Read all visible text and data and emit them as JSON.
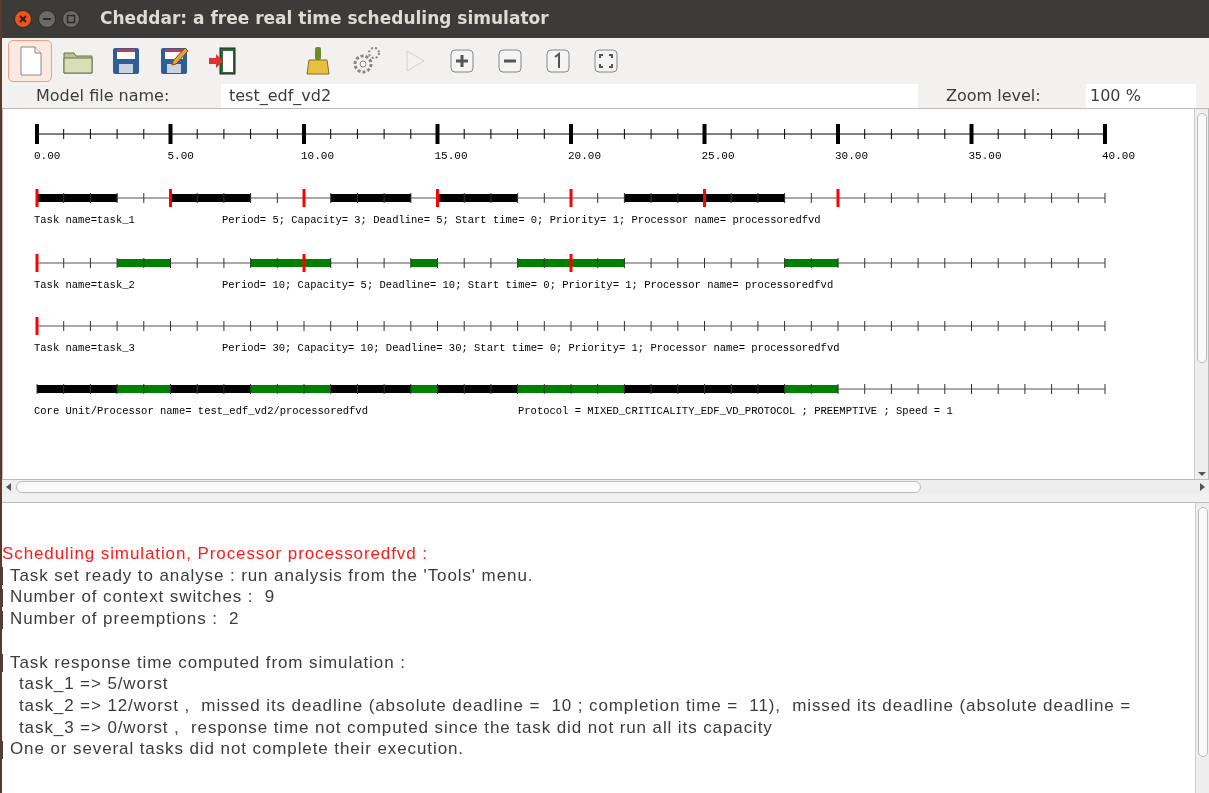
{
  "window": {
    "title": "Cheddar: a free real time scheduling simulator"
  },
  "toolbar": [
    {
      "kind": "new",
      "selected": true,
      "disabled": false
    },
    {
      "kind": "open",
      "selected": false,
      "disabled": false
    },
    {
      "kind": "save",
      "selected": false,
      "disabled": false
    },
    {
      "kind": "save-as",
      "selected": false,
      "disabled": false
    },
    {
      "kind": "exit",
      "selected": false,
      "disabled": false
    },
    {
      "kind": "gap"
    },
    {
      "kind": "clear",
      "selected": false,
      "disabled": false
    },
    {
      "kind": "gears",
      "selected": false,
      "disabled": false
    },
    {
      "kind": "play",
      "selected": false,
      "disabled": true
    },
    {
      "kind": "zoom-in",
      "selected": false,
      "disabled": false
    },
    {
      "kind": "zoom-out",
      "selected": false,
      "disabled": false
    },
    {
      "kind": "zoom-reset",
      "selected": false,
      "disabled": false
    },
    {
      "kind": "zoom-fit",
      "selected": false,
      "disabled": false
    }
  ],
  "info": {
    "model_label": "Model file name:",
    "model_value": "test_edf_vd2",
    "zoom_label": "Zoom level:",
    "zoom_value": "100 %"
  },
  "schedule": {
    "axis_labels": [
      "0.00",
      "5.00",
      "10.00",
      "15.00",
      "20.00",
      "25.00",
      "30.00",
      "35.00",
      "40.00"
    ],
    "rows": [
      {
        "kind": "task",
        "name": "Task name=task_1",
        "details": "Period= 5; Capacity= 3; Deadline= 5; Start time= 0; Priority= 1; Processor name= processoredfvd",
        "color": "#000000",
        "slots": [
          {
            "running": true,
            "release": true
          },
          {
            "running": true,
            "release": false
          },
          {
            "running": true,
            "release": false
          },
          {
            "running": false,
            "release": false
          },
          {
            "running": false,
            "release": false
          },
          {
            "running": true,
            "release": true
          },
          {
            "running": true,
            "release": false
          },
          {
            "running": true,
            "release": false
          },
          {
            "running": false,
            "release": false
          },
          {
            "running": false,
            "release": false
          },
          {
            "running": false,
            "release": true
          },
          {
            "running": true,
            "release": false
          },
          {
            "running": true,
            "release": false
          },
          {
            "running": true,
            "release": false
          },
          {
            "running": false,
            "release": false
          },
          {
            "running": true,
            "release": true
          },
          {
            "running": true,
            "release": false
          },
          {
            "running": true,
            "release": false
          },
          {
            "running": false,
            "release": false
          },
          {
            "running": false,
            "release": false
          },
          {
            "running": false,
            "release": true
          },
          {
            "running": false,
            "release": false
          },
          {
            "running": true,
            "release": false
          },
          {
            "running": true,
            "release": false
          },
          {
            "running": true,
            "release": false
          },
          {
            "running": true,
            "release": true
          },
          {
            "running": true,
            "release": false
          },
          {
            "running": true,
            "release": false
          },
          {
            "running": false,
            "release": false
          },
          {
            "running": false,
            "release": false
          },
          {
            "running": false,
            "release": true
          },
          {
            "running": false,
            "release": false
          },
          {
            "running": false,
            "release": false
          },
          {
            "running": false,
            "release": false
          },
          {
            "running": false,
            "release": false
          },
          {
            "running": false,
            "release": false
          },
          {
            "running": false,
            "release": false
          },
          {
            "running": false,
            "release": false
          },
          {
            "running": false,
            "release": false
          },
          {
            "running": false,
            "release": false
          }
        ]
      },
      {
        "kind": "task",
        "name": "Task name=task_2",
        "details": "Period= 10; Capacity= 5; Deadline= 10; Start time= 0; Priority= 1; Processor name= processoredfvd",
        "color": "#008000",
        "slots": [
          {
            "running": false,
            "release": true
          },
          {
            "running": false,
            "release": false
          },
          {
            "running": false,
            "release": false
          },
          {
            "running": true,
            "release": false
          },
          {
            "running": true,
            "release": false
          },
          {
            "running": false,
            "release": false
          },
          {
            "running": false,
            "release": false
          },
          {
            "running": false,
            "release": false
          },
          {
            "running": true,
            "release": false
          },
          {
            "running": true,
            "release": false
          },
          {
            "running": true,
            "release": true
          },
          {
            "running": false,
            "release": false
          },
          {
            "running": false,
            "release": false
          },
          {
            "running": false,
            "release": false
          },
          {
            "running": true,
            "release": false
          },
          {
            "running": false,
            "release": false
          },
          {
            "running": false,
            "release": false
          },
          {
            "running": false,
            "release": false
          },
          {
            "running": true,
            "release": false
          },
          {
            "running": true,
            "release": false
          },
          {
            "running": true,
            "release": true
          },
          {
            "running": true,
            "release": false
          },
          {
            "running": false,
            "release": false
          },
          {
            "running": false,
            "release": false
          },
          {
            "running": false,
            "release": false
          },
          {
            "running": false,
            "release": false
          },
          {
            "running": false,
            "release": false
          },
          {
            "running": false,
            "release": false
          },
          {
            "running": true,
            "release": false
          },
          {
            "running": true,
            "release": false
          },
          {
            "running": false,
            "release": false
          },
          {
            "running": false,
            "release": false
          },
          {
            "running": false,
            "release": false
          },
          {
            "running": false,
            "release": false
          },
          {
            "running": false,
            "release": false
          },
          {
            "running": false,
            "release": false
          },
          {
            "running": false,
            "release": false
          },
          {
            "running": false,
            "release": false
          },
          {
            "running": false,
            "release": false
          },
          {
            "running": false,
            "release": false
          }
        ]
      },
      {
        "kind": "task",
        "name": "Task name=task_3",
        "details": "Period= 30; Capacity= 10; Deadline= 30; Start time= 0; Priority= 1; Processor name= processoredfvd",
        "slots": [
          {
            "running": false,
            "release": true
          },
          {
            "running": false,
            "release": false
          },
          {
            "running": false,
            "release": false
          },
          {
            "running": false,
            "release": false
          },
          {
            "running": false,
            "release": false
          },
          {
            "running": false,
            "release": false
          },
          {
            "running": false,
            "release": false
          },
          {
            "running": false,
            "release": false
          },
          {
            "running": false,
            "release": false
          },
          {
            "running": false,
            "release": false
          },
          {
            "running": false,
            "release": false
          },
          {
            "running": false,
            "release": false
          },
          {
            "running": false,
            "release": false
          },
          {
            "running": false,
            "release": false
          },
          {
            "running": false,
            "release": false
          },
          {
            "running": false,
            "release": false
          },
          {
            "running": false,
            "release": false
          },
          {
            "running": false,
            "release": false
          },
          {
            "running": false,
            "release": false
          },
          {
            "running": false,
            "release": false
          },
          {
            "running": false,
            "release": false
          },
          {
            "running": false,
            "release": false
          },
          {
            "running": false,
            "release": false
          },
          {
            "running": false,
            "release": false
          },
          {
            "running": false,
            "release": false
          },
          {
            "running": false,
            "release": false
          },
          {
            "running": false,
            "release": false
          },
          {
            "running": false,
            "release": false
          },
          {
            "running": false,
            "release": false
          },
          {
            "running": false,
            "release": false
          },
          {
            "running": false,
            "release": false
          },
          {
            "running": false,
            "release": false
          },
          {
            "running": false,
            "release": false
          },
          {
            "running": false,
            "release": false
          },
          {
            "running": false,
            "release": false
          },
          {
            "running": false,
            "release": false
          },
          {
            "running": false,
            "release": false
          },
          {
            "running": false,
            "release": false
          },
          {
            "running": false,
            "release": false
          },
          {
            "running": false,
            "release": false
          }
        ]
      },
      {
        "kind": "processor",
        "name": "Core Unit/Processor name= test_edf_vd2/processoredfvd",
        "details": "Protocol = MIXED_CRITICALITY_EDF_VD_PROTOCOL ; PREEMPTIVE ; Speed =  1",
        "slots": [
          {
            "running": true,
            "color": "#000000"
          },
          {
            "running": true,
            "color": "#000000"
          },
          {
            "running": true,
            "color": "#000000"
          },
          {
            "running": true,
            "color": "#008000"
          },
          {
            "running": true,
            "color": "#008000"
          },
          {
            "running": true,
            "color": "#000000"
          },
          {
            "running": true,
            "color": "#000000"
          },
          {
            "running": true,
            "color": "#000000"
          },
          {
            "running": true,
            "color": "#008000"
          },
          {
            "running": true,
            "color": "#008000"
          },
          {
            "running": true,
            "color": "#008000"
          },
          {
            "running": true,
            "color": "#000000"
          },
          {
            "running": true,
            "color": "#000000"
          },
          {
            "running": true,
            "color": "#000000"
          },
          {
            "running": true,
            "color": "#008000"
          },
          {
            "running": true,
            "color": "#000000"
          },
          {
            "running": true,
            "color": "#000000"
          },
          {
            "running": true,
            "color": "#000000"
          },
          {
            "running": true,
            "color": "#008000"
          },
          {
            "running": true,
            "color": "#008000"
          },
          {
            "running": true,
            "color": "#008000"
          },
          {
            "running": true,
            "color": "#008000"
          },
          {
            "running": true,
            "color": "#000000"
          },
          {
            "running": true,
            "color": "#000000"
          },
          {
            "running": true,
            "color": "#000000"
          },
          {
            "running": true,
            "color": "#000000"
          },
          {
            "running": true,
            "color": "#000000"
          },
          {
            "running": true,
            "color": "#000000"
          },
          {
            "running": true,
            "color": "#008000"
          },
          {
            "running": true,
            "color": "#008000"
          },
          {
            "running": false
          },
          {
            "running": false
          },
          {
            "running": false
          },
          {
            "running": false
          },
          {
            "running": false
          },
          {
            "running": false
          },
          {
            "running": false
          },
          {
            "running": false
          },
          {
            "running": false
          },
          {
            "running": false
          }
        ]
      }
    ]
  },
  "log": [
    {
      "kind": "heading",
      "text": "Scheduling simulation, Processor processoredfvd :"
    },
    {
      "kind": "bullet",
      "text": "Task set ready to analyse : run analysis from the 'Tools' menu."
    },
    {
      "kind": "bullet",
      "text": "Number of context switches :  9"
    },
    {
      "kind": "bullet",
      "text": "Number of preemptions :  2"
    },
    {
      "kind": "blank"
    },
    {
      "kind": "bullet",
      "text": "Task response time computed from simulation :"
    },
    {
      "kind": "indent",
      "text": "task_1 => 5/worst"
    },
    {
      "kind": "indent",
      "text": "task_2 => 12/worst ,  missed its deadline (absolute deadline =  10 ; completion time =  11),  missed its deadline (absolute deadline ="
    },
    {
      "kind": "indent",
      "text": "task_3 => 0/worst ,  response time not computed since the task did not run all its capacity"
    },
    {
      "kind": "bullet",
      "text": "One or several tasks did not complete their execution."
    }
  ]
}
